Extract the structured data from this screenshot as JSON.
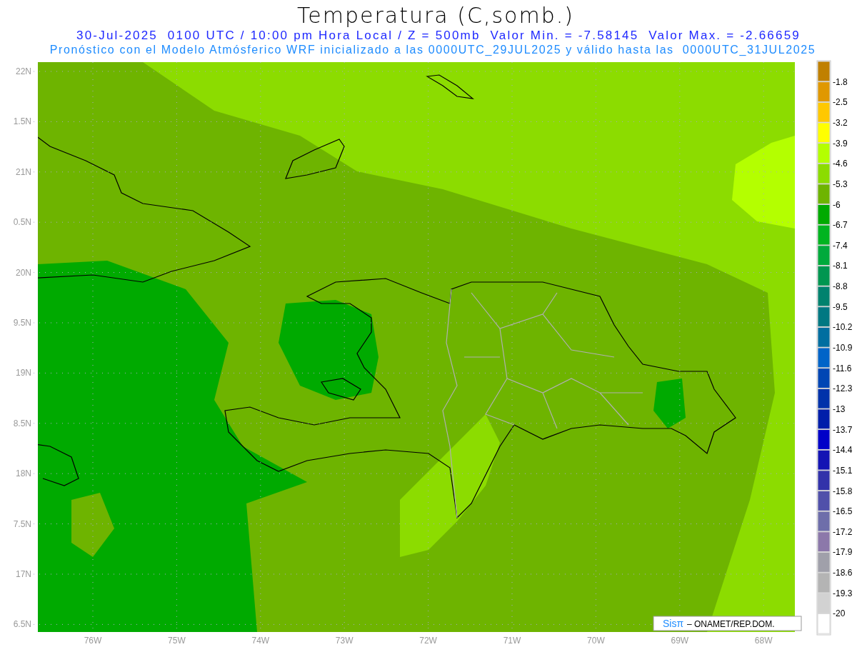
{
  "title": "Temperatura (C,somb.)",
  "subtitle": "30-Jul-2025  0100 UTC / 10:00 pm Hora Local / Z = 500mb  Valor Min. = -7.58145  Valor Max. = -2.66659",
  "info": "Pronóstico con el Modelo Atmósferico WRF inicializado a las 0000UTC_29JUL2025 y válido hasta las  0000UTC_31JUL2025",
  "y_labels": [
    "22N",
    "1.5N",
    "21N",
    "0.5N",
    "20N",
    "9.5N",
    "19N",
    "8.5N",
    "18N",
    "7.5N",
    "17N",
    "6.5N"
  ],
  "x_labels": [
    "76W",
    "75W",
    "74W",
    "73W",
    "72W",
    "71W",
    "70W",
    "69W",
    "68W"
  ],
  "colorbar": {
    "bins": [
      {
        "color": "#c08000"
      },
      {
        "color": "#e09800"
      },
      {
        "color": "#ffc800"
      },
      {
        "color": "#ffff00"
      },
      {
        "color": "#b4ff00"
      },
      {
        "color": "#8cdc00"
      },
      {
        "color": "#6eb400"
      },
      {
        "color": "#00aa00"
      },
      {
        "color": "#00b420"
      },
      {
        "color": "#00aa3c"
      },
      {
        "color": "#009650"
      },
      {
        "color": "#00826e"
      },
      {
        "color": "#007882"
      },
      {
        "color": "#006ea0"
      },
      {
        "color": "#0064c8"
      },
      {
        "color": "#0046b4"
      },
      {
        "color": "#0032aa"
      },
      {
        "color": "#001eaa"
      },
      {
        "color": "#0000c8"
      },
      {
        "color": "#1414b4"
      },
      {
        "color": "#3232aa"
      },
      {
        "color": "#5050aa"
      },
      {
        "color": "#6e6eaa"
      },
      {
        "color": "#8c78aa"
      },
      {
        "color": "#a0a0aa"
      },
      {
        "color": "#b4b4b4"
      },
      {
        "color": "#d2d2d2"
      },
      {
        "color": "#ffffff"
      }
    ],
    "labels": [
      "-1.8",
      "-2.5",
      "-3.2",
      "-3.9",
      "-4.6",
      "-5.3",
      "-6",
      "-6.7",
      "-7.4",
      "-8.1",
      "-8.8",
      "-9.5",
      "-10.2",
      "-10.9",
      "-11.6",
      "-12.3",
      "-13",
      "-13.7",
      "-14.4",
      "-15.1",
      "-15.8",
      "-16.5",
      "-17.2",
      "-17.9",
      "-18.6",
      "-19.3",
      "-20"
    ]
  },
  "credit": {
    "logo": "Sisπ",
    "text": "– ONAMET/REP.DOM."
  }
}
